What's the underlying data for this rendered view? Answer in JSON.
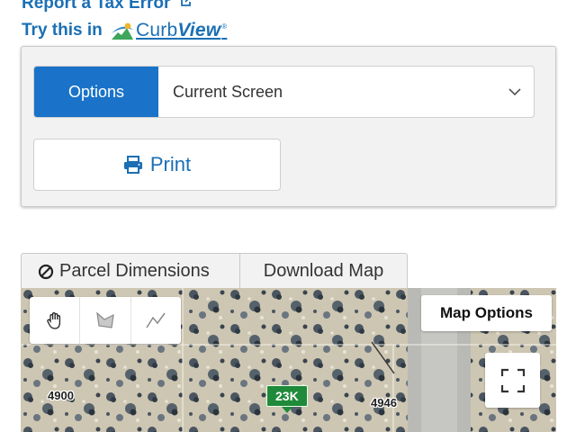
{
  "links": {
    "report_tax_error": "Report a Tax Error",
    "try_this_in": "Try this in",
    "curbview_brand_a": "Curb",
    "curbview_brand_b": "View",
    "curbview_reg": "®"
  },
  "options_panel": {
    "select_label": "Options",
    "select_value": "Current Screen",
    "print_label": "Print"
  },
  "map_tabs": [
    {
      "label": "Parcel Dimensions"
    },
    {
      "label": "Download Map"
    }
  ],
  "map": {
    "map_options_label": "Map Options",
    "parcel_labels": [
      "4900",
      "4946"
    ],
    "marker_label": "23K",
    "tools": [
      "pan-hand-icon",
      "draw-area-icon",
      "draw-line-icon"
    ],
    "fullscreen_icon": "fullscreen-icon"
  },
  "colors": {
    "link": "#1a6fb5",
    "primary": "#1a73c8",
    "marker": "#1f8a3a"
  }
}
